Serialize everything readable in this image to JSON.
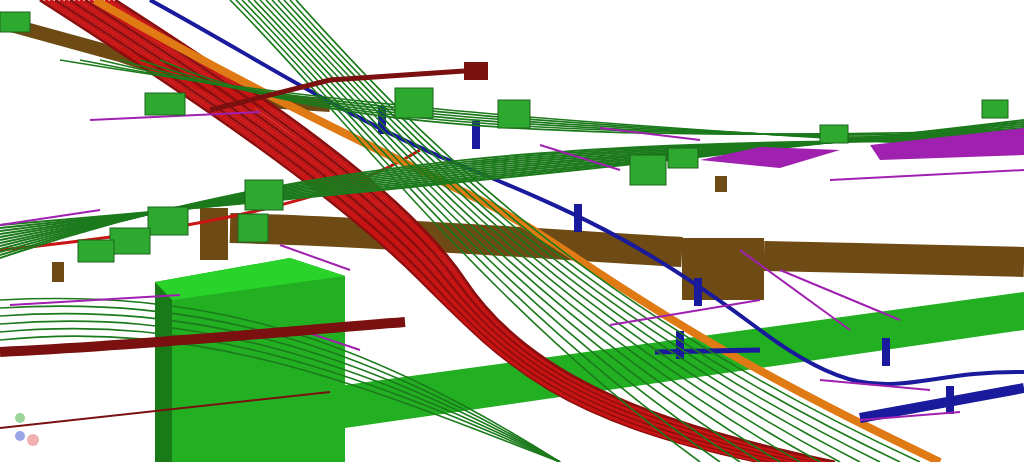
{
  "scene": {
    "networks": [
      {
        "kind": "duct"
      },
      {
        "kind": "slab"
      },
      {
        "kind": "cable-bundle"
      },
      {
        "kind": "pipe"
      },
      {
        "kind": "water-line"
      },
      {
        "kind": "conduit"
      },
      {
        "kind": "fiber"
      },
      {
        "kind": "sewer"
      },
      {
        "kind": "chamber"
      }
    ]
  }
}
